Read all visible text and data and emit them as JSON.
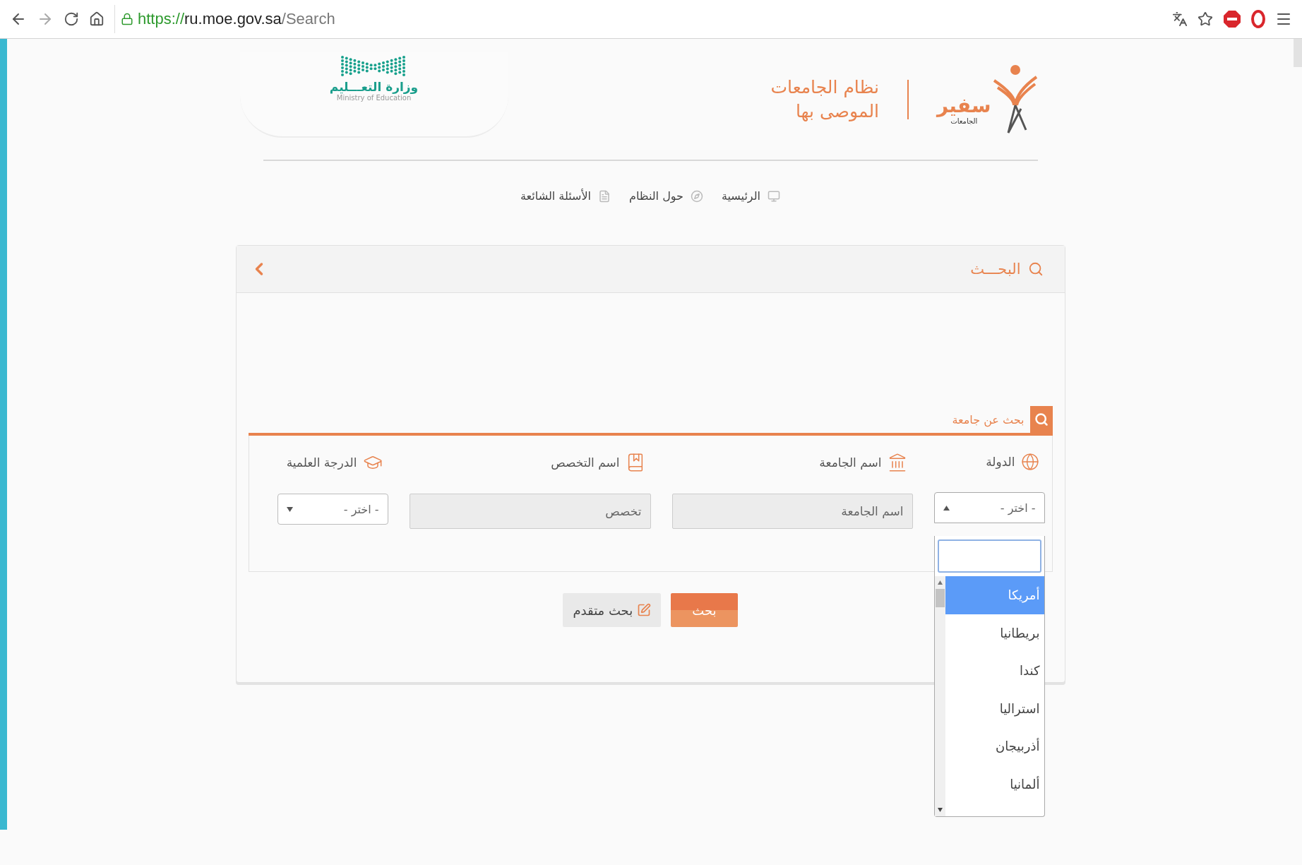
{
  "browser": {
    "url_scheme": "https://",
    "url_host": "ru.moe.gov.sa",
    "url_path": "/Search"
  },
  "header": {
    "ministry_logo": {
      "name_ar": "وزارة التعـــليم",
      "name_en": "Ministry of Education"
    },
    "brand_logo": {
      "name": "سفير",
      "subtitle": "الجامعات"
    },
    "title_lines": [
      "نظام الجامعات",
      "الموصى بها"
    ]
  },
  "nav": [
    {
      "label": "الرئيسية",
      "kind": "home"
    },
    {
      "label": "حول النظام",
      "kind": "about"
    },
    {
      "label": "الأسئلة الشائعة",
      "kind": "faq"
    }
  ],
  "panel": {
    "title": "البحـــث",
    "section_tab": "بحث عن جامعة",
    "fields": [
      {
        "label": "الدولة",
        "kind": "select",
        "placeholder": "- اختر -",
        "expanded": true
      },
      {
        "label": "اسم الجامعة",
        "kind": "text",
        "placeholder": "اسم الجامعة"
      },
      {
        "label": "اسم التخصص",
        "kind": "text",
        "placeholder": "تخصص"
      },
      {
        "label": "الدرجة العلمية",
        "kind": "select",
        "placeholder": "- اختر -",
        "expanded": false
      }
    ],
    "buttons": [
      {
        "label": "بحث",
        "kind": "primary"
      },
      {
        "label": "بحث متقدم",
        "kind": "secondary"
      }
    ]
  },
  "dropdown": {
    "options": [
      {
        "label": "أمريكا",
        "selected": true
      },
      {
        "label": "بريطانيا",
        "selected": false
      },
      {
        "label": "كندا",
        "selected": false
      },
      {
        "label": "استراليا",
        "selected": false
      },
      {
        "label": "أذربيجان",
        "selected": false
      },
      {
        "label": "ألمانيا",
        "selected": false
      }
    ]
  }
}
